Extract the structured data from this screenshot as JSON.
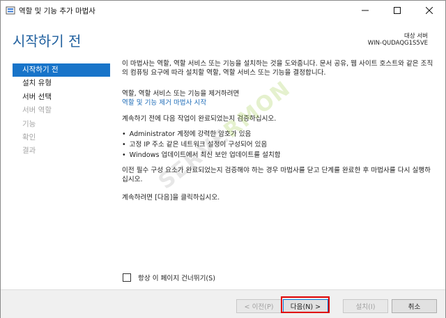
{
  "window": {
    "title": "역할 및 기능 추가 마법사",
    "minimize_glyph": "—",
    "maximize_glyph": "☐",
    "close_glyph": "✕"
  },
  "header": {
    "page_title": "시작하기 전",
    "target_label": "대상 서버",
    "target_value": "WIN-QUDAQG1S5VE"
  },
  "nav": {
    "items": [
      {
        "label": "시작하기 전",
        "state": "selected"
      },
      {
        "label": "설치 유형",
        "state": "normal"
      },
      {
        "label": "서버 선택",
        "state": "normal"
      },
      {
        "label": "서버 역할",
        "state": "disabled"
      },
      {
        "label": "기능",
        "state": "disabled"
      },
      {
        "label": "확인",
        "state": "disabled"
      },
      {
        "label": "결과",
        "state": "disabled"
      }
    ]
  },
  "content": {
    "para1": "이 마법사는 역할, 역할 서비스 또는 기능을 설치하는 것을 도와줍니다. 문서 공유, 웹 사이트 호스트와 같은 조직의 컴퓨팅 요구에 따라 설치할 역할, 역할 서비스 또는 기능을 결정합니다.",
    "para2": "역할, 역할 서비스 또는 기능을 제거하려면",
    "link": "역할 및 기능 제거 마법사 시작",
    "para3": "계속하기 전에 다음 작업이 완료되었는지 검증하십시오.",
    "bullets": [
      "Administrator 계정에 강력한 암호가 있음",
      "고정 IP 주소 같은 네트워크 설정이 구성되어 있음",
      "Windows 업데이트에서 최신 보안 업데이트를 설치함"
    ],
    "para4": "이전 필수 구성 요소가 완료되었는지 검증해야 하는 경우 마법사를 닫고 단계를 완료한 후 마법사를 다시 실행하십시오.",
    "para5": "계속하려면 [다음]을 클릭하십시오.",
    "skip_label": "항상 이 페이지 건너뛰기(S)",
    "skip_checked": false
  },
  "footer": {
    "prev_label": "< 이전(P)",
    "next_label": "다음(N) >",
    "install_label": "설치(I)",
    "cancel_label": "취소"
  },
  "watermark": {
    "prefix": "SERVE",
    "suffix": "RMON"
  },
  "colors": {
    "accent": "#1874c9",
    "title": "#1f5f9e",
    "link": "#1f6db8",
    "highlight": "#e00000"
  }
}
